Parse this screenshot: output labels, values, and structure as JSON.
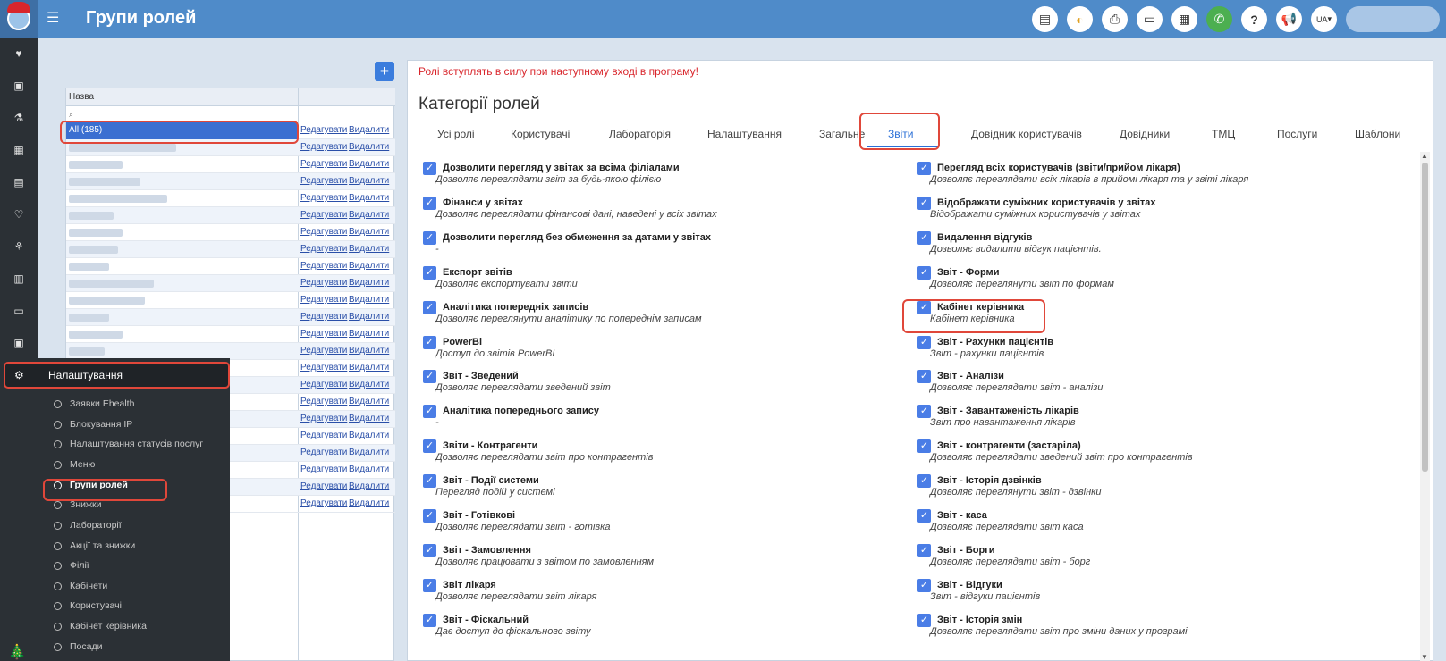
{
  "header": {
    "title": "Групи ролей",
    "lang": "UA",
    "icons": [
      "chat-icon",
      "google-chrome-icon",
      "pdf-icon",
      "card-icon",
      "calculator-icon",
      "phone-icon",
      "help-icon",
      "megaphone-icon"
    ]
  },
  "sidebar_icons": [
    "heart-icon",
    "badge-icon",
    "flask-icon",
    "calendar-icon",
    "document-icon",
    "heartbeat-icon",
    "network-icon",
    "book-icon",
    "folder-icon",
    "money-icon",
    "cogs-icon",
    "table-icon",
    "notepad-icon",
    "copy-icon",
    "copy-icon",
    "copy-icon"
  ],
  "submenu": {
    "header": "Налаштування",
    "items": [
      "Заявки Ehealth",
      "Блокування IP",
      "Налаштування статусів послуг",
      "Меню",
      "Групи ролей",
      "Знижки",
      "Лабораторії",
      "Акції та знижки",
      "Філії",
      "Кабінети",
      "Користувачі",
      "Кабінет керівника",
      "Посади"
    ]
  },
  "roles_table": {
    "header": "Назва",
    "first_row": "All (185)",
    "edit_label": "Редагувати",
    "delete_label": "Видалити",
    "row_count": 23
  },
  "main": {
    "notice": "Ролі вступлять в силу при наступному вході в програму!",
    "title": "Категорії ролей",
    "tabs": [
      "Усі ролі",
      "Користувачі",
      "Лабораторія",
      "Налаштування",
      "Загальне",
      "Звіти",
      "Довідник користувачів",
      "Довідники",
      "ТМЦ",
      "Послуги",
      "Шаблони"
    ],
    "active_tab": "Звіти",
    "left_permissions": [
      {
        "title": "Дозволити перегляд у звітах за всіма філіалами",
        "desc": "Дозволяє переглядати звіт за будь-якою філією"
      },
      {
        "title": "Фінанси у звітах",
        "desc": "Дозволяє переглядати фінансові дані, наведені у всіх звітах"
      },
      {
        "title": "Дозволити перегляд без обмеження за датами у звітах",
        "desc": "-"
      },
      {
        "title": "Експорт звітів",
        "desc": "Дозволяє експортувати звіти"
      },
      {
        "title": "Аналітика попередніх записів",
        "desc": "Дозволяє переглянути аналітику по попереднім записам"
      },
      {
        "title": "PowerBi",
        "desc": "Доступ до звітів PowerBI"
      },
      {
        "title": "Звіт - Зведений",
        "desc": "Дозволяє переглядати зведений звіт"
      },
      {
        "title": "Аналітика попереднього запису",
        "desc": "-"
      },
      {
        "title": "Звіти - Контрагенти",
        "desc": "Дозволяє переглядати звіт про контрагентів"
      },
      {
        "title": "Звіт - Події системи",
        "desc": "Перегляд подій у системі"
      },
      {
        "title": "Звіт - Готівкові",
        "desc": "Дозволяє переглядати звіт - готівка"
      },
      {
        "title": "Звіт - Замовлення",
        "desc": "Дозволяє працювати з звітом по замовленням"
      },
      {
        "title": "Звіт лікаря",
        "desc": "Дозволяє переглядати звіт лікаря"
      },
      {
        "title": "Звіт - Фіскальний",
        "desc": "Дає доступ до фіскального звіту"
      }
    ],
    "right_permissions": [
      {
        "title": "Перегляд всіх користувачів (звіти/прийом лікаря)",
        "desc": "Дозволяє переглядати всіх лікарів в прийомі лікаря та у звіті лікаря"
      },
      {
        "title": "Відображати суміжних користувачів у звітах",
        "desc": "Відображати суміжних користувачів у звітах"
      },
      {
        "title": "Видалення відгуків",
        "desc": "Дозволяє видалити відгук пацієнтів."
      },
      {
        "title": "Звіт - Форми",
        "desc": "Дозволяє переглянути звіт по формам"
      },
      {
        "title": "Кабінет керівника",
        "desc": "Кабінет керівника"
      },
      {
        "title": "Звіт - Рахунки пацієнтів",
        "desc": "Звіт - рахунки пацієнтів"
      },
      {
        "title": "Звіт - Аналізи",
        "desc": "Дозволяє переглядати звіт - аналізи"
      },
      {
        "title": "Звіт - Завантаженість лікарів",
        "desc": "Звіт про навантаження лікарів"
      },
      {
        "title": "Звіт - контрагенти (застаріла)",
        "desc": "Дозволяє переглядати зведений звіт про контрагентів"
      },
      {
        "title": "Звіт - Історія дзвінків",
        "desc": "Дозволяє переглянути звіт - дзвінки"
      },
      {
        "title": "Звіт - каса",
        "desc": "Дозволяє переглядати звіт каса"
      },
      {
        "title": "Звіт - Борги",
        "desc": "Дозволяє переглядати звіт - борг"
      },
      {
        "title": "Звіт - Відгуки",
        "desc": "Звіт - відгуки пацієнтів"
      },
      {
        "title": "Звіт - Історія змін",
        "desc": "Дозволяє переглядати звіт про зміни даних у програмі"
      }
    ]
  },
  "colors": {
    "accent": "#4f8bc9",
    "highlight": "#e0473a",
    "checkbox": "#4a7de6",
    "notice": "#d9262c"
  }
}
